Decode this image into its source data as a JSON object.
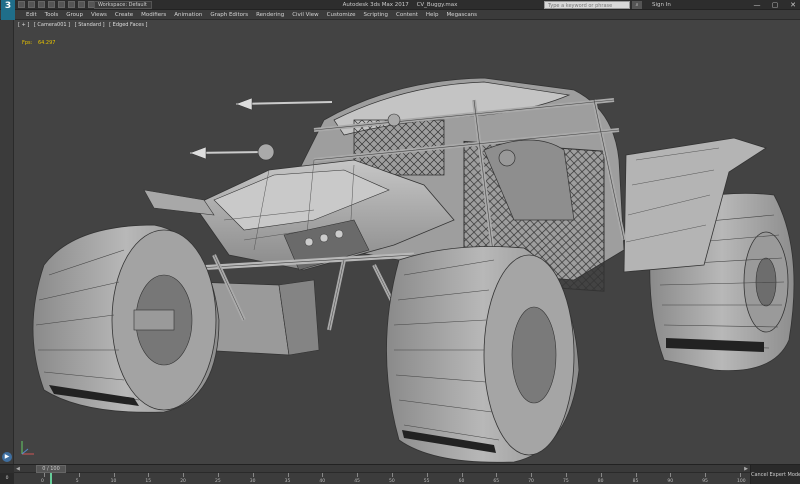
{
  "app": {
    "logo_text": "3",
    "workspace": "Workspace: Default",
    "title_app": "Autodesk 3ds Max 2017",
    "title_file": "CV_Buggy.max",
    "search_placeholder": "Type a keyword or phrase",
    "sign_in": "Sign In",
    "min": "—",
    "max": "▢",
    "close": "✕"
  },
  "menu": [
    "Edit",
    "Tools",
    "Group",
    "Views",
    "Create",
    "Modifiers",
    "Animation",
    "Graph Editors",
    "Rendering",
    "Civil View",
    "Customize",
    "Scripting",
    "Content",
    "Help",
    "Megascans"
  ],
  "viewport": {
    "label_plus": "[ + ]",
    "label_camera": "[ Camera001 ]",
    "label_shading": "[ Standard ]",
    "label_mode": "[ Edged Faces ]",
    "fps_label": "Fps:",
    "fps_value": "64.297"
  },
  "timeline": {
    "position": "0 / 100",
    "frame": "0",
    "ticks": [
      "0",
      "5",
      "10",
      "15",
      "20",
      "25",
      "30",
      "35",
      "40",
      "45",
      "50",
      "55",
      "60",
      "65",
      "70",
      "75",
      "80",
      "85",
      "90",
      "95",
      "100"
    ],
    "expert_mode": "Cancel Expert Mode"
  },
  "icons": {
    "play": "play-icon",
    "prev": "chevron-left-icon",
    "next": "chevron-right-icon"
  }
}
